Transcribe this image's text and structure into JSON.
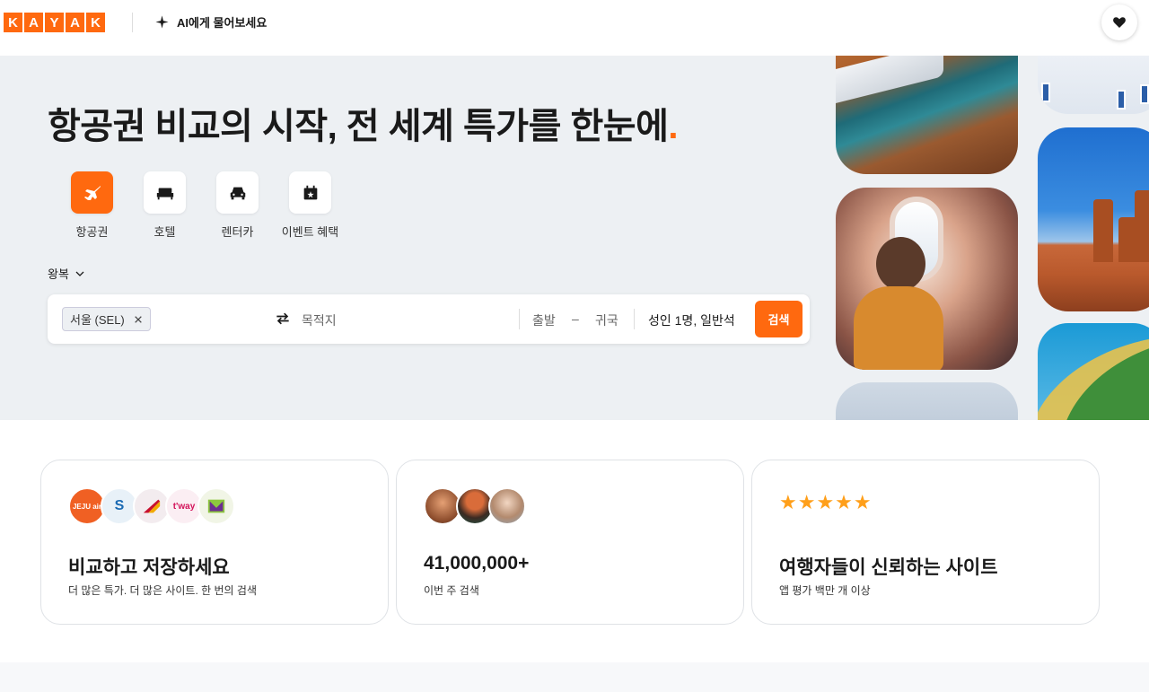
{
  "header": {
    "logo_letters": [
      "K",
      "A",
      "Y",
      "A",
      "K"
    ],
    "ai_label": "AI에게 물어보세요"
  },
  "hero": {
    "headline": "항공권 비교의 시작, 전 세계 특가를 한눈에",
    "headline_dot": ".",
    "verticals": [
      {
        "label": "항공권",
        "icon": "plane-icon",
        "active": true
      },
      {
        "label": "호텔",
        "icon": "bed-icon",
        "active": false
      },
      {
        "label": "렌터카",
        "icon": "car-icon",
        "active": false
      },
      {
        "label": "이벤트 혜택",
        "icon": "gift-calendar-icon",
        "active": false
      }
    ],
    "trip_type": "왕복"
  },
  "search": {
    "origin_chip": "서울 (SEL)",
    "destination_placeholder": "목적지",
    "depart_placeholder": "출발",
    "dash": "–",
    "return_placeholder": "귀국",
    "travelers": "성인 1명, 일반석",
    "search_label": "검색"
  },
  "cards": [
    {
      "title": "비교하고 저장하세요",
      "sub": "더 많은 특가. 더 많은 사이트. 한 번의 검색",
      "logos": [
        "JEJU air",
        "S",
        "",
        "t'way",
        ""
      ]
    },
    {
      "title": "41,000,000+",
      "sub": "이번 주 검색"
    },
    {
      "title": "여행자들이 신뢰하는 사이트",
      "sub": "앱 평가 백만 개 이상",
      "stars": "★★★★★"
    }
  ],
  "colors": {
    "brand": "#ff690f",
    "hero_bg": "#edf0f3",
    "star": "#ff9f1a"
  }
}
